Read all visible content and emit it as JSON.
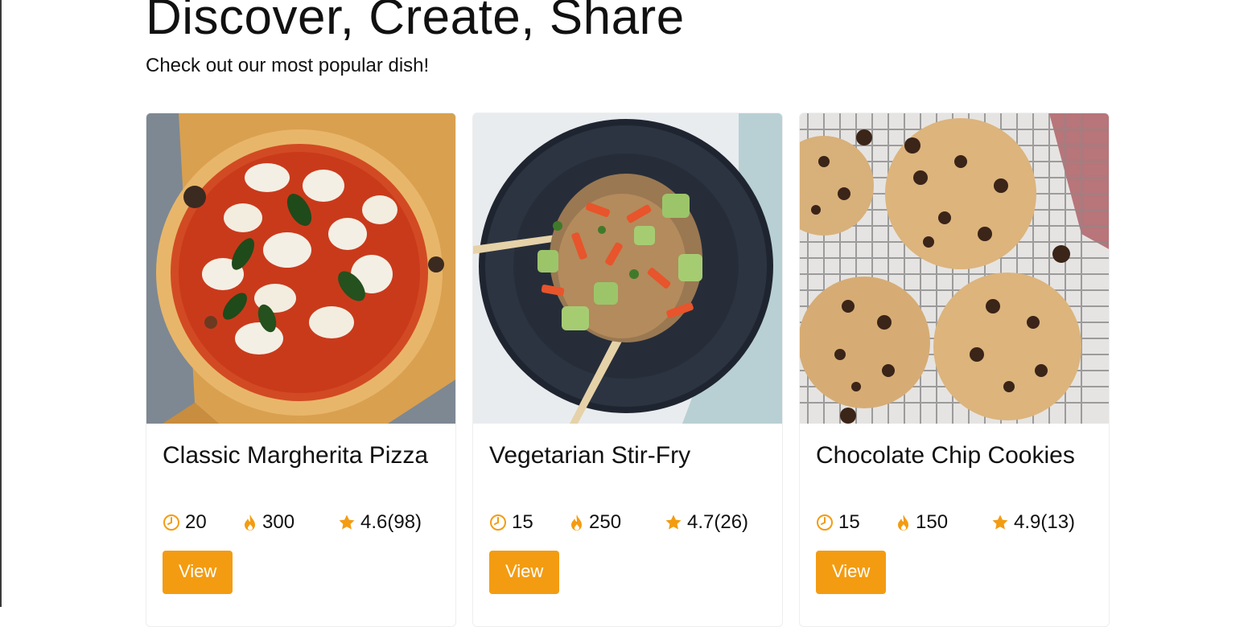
{
  "hero": {
    "title": "Discover, Create, Share",
    "subtitle": "Check out our most popular dish!"
  },
  "accent_color": "#f39c12",
  "recipes": [
    {
      "title": "Classic Margherita Pizza",
      "image_icon": "pizza-image",
      "time": "20",
      "calories": "300",
      "rating": "4.6(98)",
      "button": "View"
    },
    {
      "title": "Vegetarian Stir-Fry",
      "image_icon": "stir-fry-image",
      "time": "15",
      "calories": "250",
      "rating": "4.7(26)",
      "button": "View"
    },
    {
      "title": "Chocolate Chip Cookies",
      "image_icon": "cookies-image",
      "time": "15",
      "calories": "150",
      "rating": "4.9(13)",
      "button": "View"
    }
  ]
}
